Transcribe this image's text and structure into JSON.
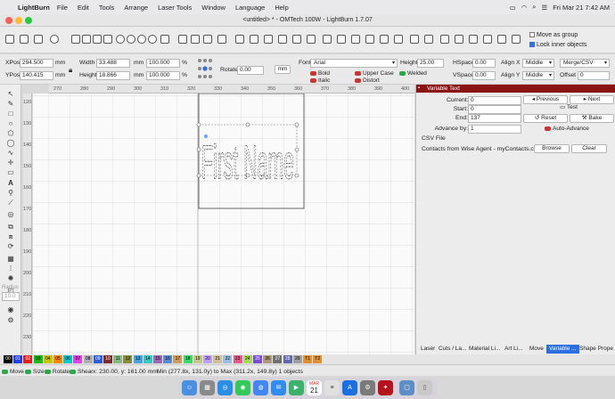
{
  "menubar": {
    "app": "LightBurn",
    "items": [
      "File",
      "Edit",
      "Tools",
      "Arrange",
      "Laser Tools",
      "Window",
      "Language",
      "Help"
    ],
    "clock": "Fri Mar 21  7:42 AM"
  },
  "window": {
    "title": "<untitled> * - OMTech 100W - LightBurn 1.7.07"
  },
  "toolbar": {
    "move_as_group": "Move as group",
    "lock_inner_objects": "Lock inner objects"
  },
  "props": {
    "xpos_label": "XPos",
    "xpos": "294.500",
    "ypos_label": "YPos",
    "ypos": "140.415",
    "unit_mm": "mm",
    "width_label": "Width",
    "width": "33.488",
    "height_label": "Height",
    "height": "18.866",
    "scale_w": "100.000",
    "scale_h": "100.000",
    "pct": "%",
    "rotate_label": "Rotate",
    "rotate": "0.00",
    "mm_button": "mm",
    "font_label": "Font",
    "font": "Arial",
    "font_height_label": "Height",
    "font_height": "25.00",
    "hspace_label": "HSpace",
    "hspace": "0.00",
    "vspace_label": "VSpace",
    "vspace": "0.00",
    "align_x_label": "Align X",
    "align_x": "Middle",
    "align_y_label": "Align Y",
    "align_y": "Middle",
    "mode": "Merge/CSV",
    "offset_label": "Offset",
    "offset": "0",
    "bold": "Bold",
    "italic": "Italic",
    "upper_case": "Upper Case",
    "distort": "Distort",
    "welded": "Welded"
  },
  "rulers": {
    "top": [
      "280",
      "290",
      "300",
      "310",
      "320",
      "330",
      "340",
      "350",
      "360",
      "370",
      "380",
      "390",
      "400",
      "410"
    ],
    "top_partial": [
      "270",
      "280"
    ],
    "left": [
      "120",
      "130",
      "140",
      "150",
      "160",
      "170",
      "180",
      "190",
      "200",
      "210",
      "220",
      "230",
      "240",
      "250",
      "260",
      "270",
      "280",
      "290",
      "300"
    ]
  },
  "canvas": {
    "text": "First Name"
  },
  "tools": {
    "radius_label": "Radius",
    "radius_value": "10.0"
  },
  "variable_text": {
    "title": "Variable Text",
    "current_label": "Current:",
    "current": "0",
    "start_label": "Start:",
    "start": "0",
    "end_label": "End:",
    "end": "137",
    "advance_label": "Advance by:",
    "advance": "1",
    "previous": "Previous",
    "next": "Next",
    "test": "Test",
    "reset": "Reset",
    "bake": "Bake",
    "auto_advance": "Auto-Advance",
    "csv_label": "CSV File",
    "csv_file": "Contacts from Wise Agent - myContacts.csv",
    "browse": "Browse",
    "clear": "Clear"
  },
  "tabs": [
    "Laser",
    "Cuts / La...",
    "Material Li...",
    "Art Li...",
    "Move",
    "Variable ...",
    "Shape Prope"
  ],
  "palette": [
    {
      "label": "00",
      "color": "#000000"
    },
    {
      "label": "01",
      "color": "#1f3ff0"
    },
    {
      "label": "02",
      "color": "#e02020"
    },
    {
      "label": "03",
      "color": "#16b916"
    },
    {
      "label": "04",
      "color": "#c9c400"
    },
    {
      "label": "05",
      "color": "#ff8800"
    },
    {
      "label": "06",
      "color": "#00c9c9"
    },
    {
      "label": "07",
      "color": "#e043e0"
    },
    {
      "label": "08",
      "color": "#b0b0b0"
    },
    {
      "label": "09",
      "color": "#2c5cd8"
    },
    {
      "label": "10",
      "color": "#7a2b2b"
    },
    {
      "label": "11",
      "color": "#86b886"
    },
    {
      "label": "12",
      "color": "#8a8a42"
    },
    {
      "label": "13",
      "color": "#4aa3d8"
    },
    {
      "label": "14",
      "color": "#39c6c6"
    },
    {
      "label": "15",
      "color": "#9c6ab0"
    },
    {
      "label": "16",
      "color": "#5a8ad0"
    },
    {
      "label": "17",
      "color": "#cf9a5c"
    },
    {
      "label": "18",
      "color": "#3fd86a"
    },
    {
      "label": "19",
      "color": "#c8c888"
    },
    {
      "label": "20",
      "color": "#c0a0ff"
    },
    {
      "label": "21",
      "color": "#d0c098"
    },
    {
      "label": "22",
      "color": "#99c0e0"
    },
    {
      "label": "23",
      "color": "#e05c8c"
    },
    {
      "label": "24",
      "color": "#a8d858"
    },
    {
      "label": "25",
      "color": "#7a4ad0"
    },
    {
      "label": "26",
      "color": "#b09878"
    },
    {
      "label": "27",
      "color": "#707070"
    },
    {
      "label": "28",
      "color": "#6068a8"
    },
    {
      "label": "29",
      "color": "#a0a0a0"
    },
    {
      "label": "T1",
      "color": "#e09030"
    },
    {
      "label": "T2",
      "color": "#e09030"
    }
  ],
  "status": {
    "move": "Move",
    "size": "Size",
    "rotate": "Rotate",
    "shear": "Shear",
    "coords": "x: 230.00, y: 161.00 mm",
    "bounds": "Min (277.8x, 131.0y) to Max (311.2x, 149.8y)  1 objects"
  },
  "dock": {
    "calendar_month": "MAR",
    "calendar_day": "21"
  }
}
